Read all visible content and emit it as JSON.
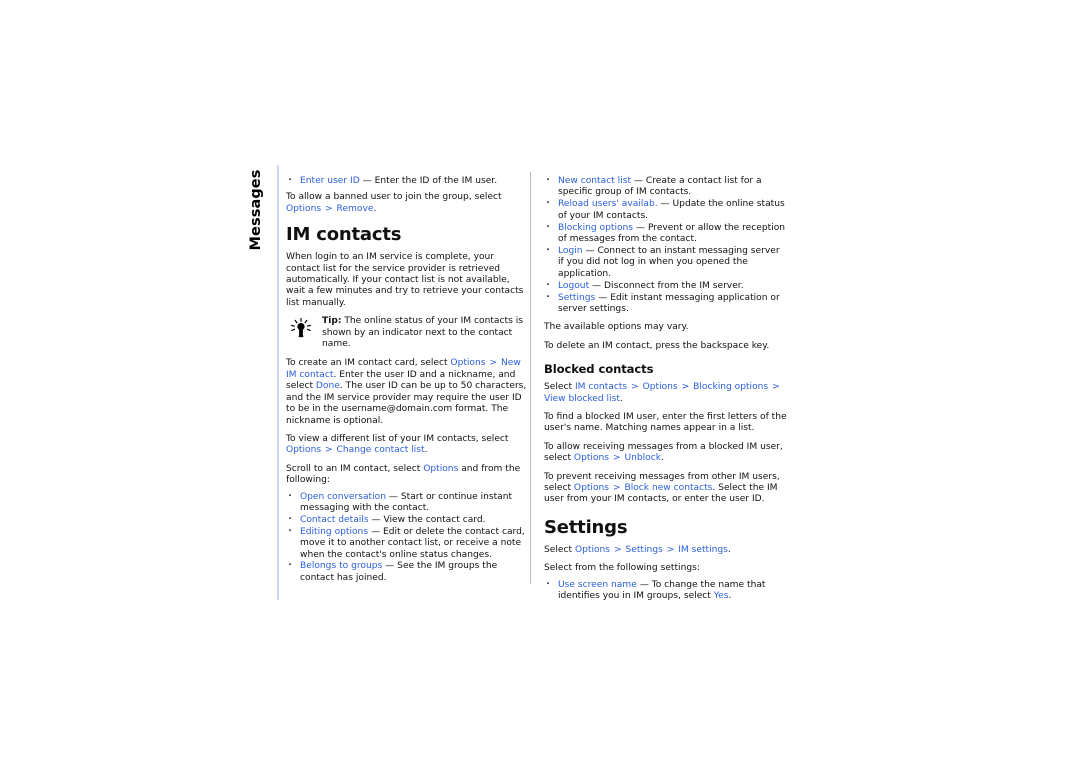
{
  "page": {
    "chapter_tab": "Messages",
    "accent_color": "#2a5fd9",
    "rule_color": "#c9d9f0",
    "background": "#ffffff",
    "text_color": "#111111"
  },
  "left_column": {
    "bullet_top": {
      "term": "Enter user ID",
      "dash": "—",
      "desc": "Enter the ID of the IM user."
    },
    "banned_para": {
      "text_1": "To allow a banned user to join the group, select ",
      "ui_1": "Options",
      "sep_1": ">",
      "ui_2": "Remove",
      "text_2": "."
    },
    "heading": "IM contacts",
    "intro_para": "When login to an IM service is complete, your contact list for the service provider is retrieved automatically. If your contact list is not available, wait a few minutes and try to retrieve your contacts list manually.",
    "tip": {
      "icon": "lightbulb-icon",
      "label": "Tip:",
      "text": " The online status of your IM contacts is shown by an indicator next to the contact name."
    },
    "create_para": {
      "text_1": "To create an IM contact card, select ",
      "ui_1": "Options",
      "sep_1": ">",
      "ui_2": "New IM contact",
      "text_2": ". Enter the user ID and a nickname, and select ",
      "ui_3": "Done",
      "text_3": ". The user ID can be up to 50 characters, and the IM service provider may require the user ID to be in the username@domain.com format. The nickname is optional."
    },
    "viewlist_para": {
      "text_1": "To view a different list of your IM contacts, select ",
      "ui_1": "Options",
      "sep_1": ">",
      "ui_2": "Change contact list",
      "text_2": "."
    },
    "scroll_para": {
      "text_1": "Scroll to an IM contact, select ",
      "ui_1": "Options",
      "text_2": " and from the following:"
    },
    "options_list": [
      {
        "term": "Open conversation",
        "dash": "—",
        "desc": "Start or continue instant messaging with the contact."
      },
      {
        "term": "Contact details",
        "dash": "—",
        "desc": "View the contact card."
      },
      {
        "term": "Editing options",
        "dash": "—",
        "desc": "Edit or delete the contact card, move it to another contact list, or receive a note when the contact's online status changes."
      },
      {
        "term": "Belongs to groups",
        "dash": "—",
        "desc": "See the IM groups the contact has joined."
      }
    ]
  },
  "right_column": {
    "options_list": [
      {
        "term": "New contact list",
        "dash": "—",
        "desc": "Create a contact list for a specific group of IM contacts."
      },
      {
        "term": "Reload users' availab.",
        "dash": "—",
        "desc": "Update the online status of your IM contacts."
      },
      {
        "term": "Blocking options",
        "dash": "—",
        "desc": "Prevent or allow the reception of messages from the contact."
      },
      {
        "term": "Login",
        "dash": "—",
        "desc": "Connect to an instant messaging server if you did not log in when you opened the application."
      },
      {
        "term": "Logout",
        "dash": "—",
        "desc": "Disconnect from the IM server."
      },
      {
        "term": "Settings",
        "dash": "—",
        "desc": "Edit instant messaging application or server settings."
      }
    ],
    "vary_para": "The available options may vary.",
    "delete_para": "To delete an IM contact, press the backspace key.",
    "blocked_heading": "Blocked contacts",
    "blocked_path": {
      "text_1": "Select ",
      "ui_1": "IM contacts",
      "sep_1": ">",
      "ui_2": "Options",
      "sep_2": ">",
      "ui_3": "Blocking options",
      "sep_3": ">",
      "ui_4": "View blocked list",
      "text_2": "."
    },
    "find_para": "To find a blocked IM user, enter the first letters of the user's name. Matching names appear in a list.",
    "allow_para": {
      "text_1": "To allow receiving messages from a blocked IM user, select ",
      "ui_1": "Options",
      "sep_1": ">",
      "ui_2": "Unblock",
      "text_2": "."
    },
    "prevent_para": {
      "text_1": "To prevent receiving messages from other IM users, select ",
      "ui_1": "Options",
      "sep_1": ">",
      "ui_2": "Block new contacts",
      "text_2": ". Select the IM user from your IM contacts, or enter the user ID."
    },
    "settings_heading": "Settings",
    "settings_path": {
      "text_1": "Select ",
      "ui_1": "Options",
      "sep_1": ">",
      "ui_2": "Settings",
      "sep_2": ">",
      "ui_3": "IM settings",
      "text_2": "."
    },
    "settings_intro": "Select from the following settings:",
    "settings_list": [
      {
        "term": "Use screen name",
        "dash": "—",
        "desc_1": "To change the name that identifies you in IM groups, select ",
        "ui_1": "Yes",
        "desc_2": "."
      }
    ]
  }
}
